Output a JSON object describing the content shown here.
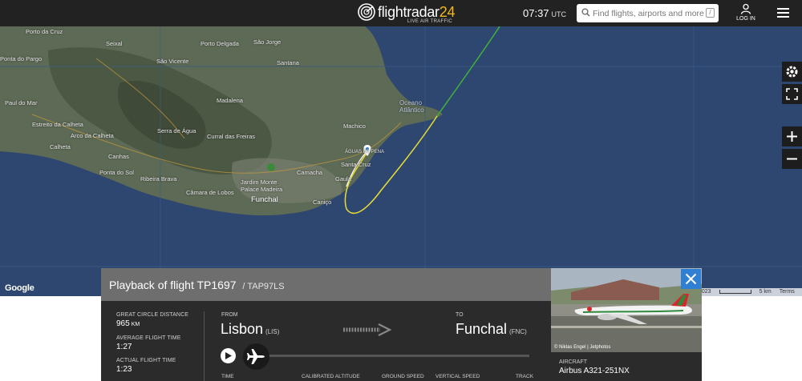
{
  "header": {
    "logo_text_main": "flightradar",
    "logo_text_num": "24",
    "logo_subtitle": "LIVE AIR TRAFFIC",
    "time": "07:37",
    "timezone": "UTC",
    "search_placeholder": "Find flights, airports and more",
    "search_shortcut": "/",
    "login_label": "LOG IN"
  },
  "map": {
    "places": {
      "porto_da_cruz": "Porto da Cruz",
      "seixal": "Seixal",
      "porto_delgada": "Porto Delgada",
      "sao_jorge": "São Jorge",
      "sao_vicente": "São Vicente",
      "santana": "Santana",
      "ponta_delgada": "Ponta do Pargo",
      "paul_do_mar": "Paul do Mar",
      "estreito": "Estreito da Calheta",
      "calheta": "Calheta",
      "arco_da_calheta": "Arco da Calheta",
      "madalena": "Madalena",
      "serra_de_agua": "Serra de Água",
      "curral": "Curral das Freiras",
      "canhas": "Canhas",
      "ponta_do_sol": "Ponta do Sol",
      "ribeira_brava": "Ribeira Brava",
      "camara_de_lobos": "Câmara de Lobos",
      "jardim": "Jardim Monte Palace Madeira",
      "funchal": "Funchal",
      "camacha": "Camacha",
      "canico": "Caniço",
      "machico": "Machico",
      "santa_cruz": "Santa Cruz",
      "gaula": "Gaula",
      "oceano": "Oceano Atlântico",
      "aguas": "ÁGUAS DE PENA"
    },
    "google_label": "Google",
    "footer_year": "2023",
    "footer_scale": "5 km",
    "footer_terms": "Terms"
  },
  "playback": {
    "title_prefix": "Playback of flight",
    "flight": "TP1697",
    "callsign": "/ TAP97LS",
    "great_circle_label": "GREAT CIRCLE DISTANCE",
    "great_circle_value": "965",
    "great_circle_unit": "KM",
    "avg_time_label": "AVERAGE FLIGHT TIME",
    "avg_time_value": "1:27",
    "actual_time_label": "ACTUAL FLIGHT TIME",
    "actual_time_value": "1:23",
    "from_label": "FROM",
    "from_city": "Lisbon",
    "from_code": "(LIS)",
    "to_label": "TO",
    "to_city": "Funchal",
    "to_code": "(FNC)",
    "columns": {
      "time": "TIME",
      "altitude": "CALIBRATED ALTITUDE",
      "ground_speed": "GROUND SPEED",
      "vertical_speed": "VERTICAL SPEED",
      "track": "TRACK"
    }
  },
  "aircraft": {
    "photo_credit": "© Niklas Engel | Jetphotos",
    "label": "AIRCRAFT",
    "value": "Airbus A321-251NX"
  },
  "colors": {
    "header_bg": "#222222",
    "map_sea": "#2e4770",
    "track_green": "#3fb23a",
    "track_yellow": "#e8dd35",
    "close_blue": "#2f7fd3"
  }
}
